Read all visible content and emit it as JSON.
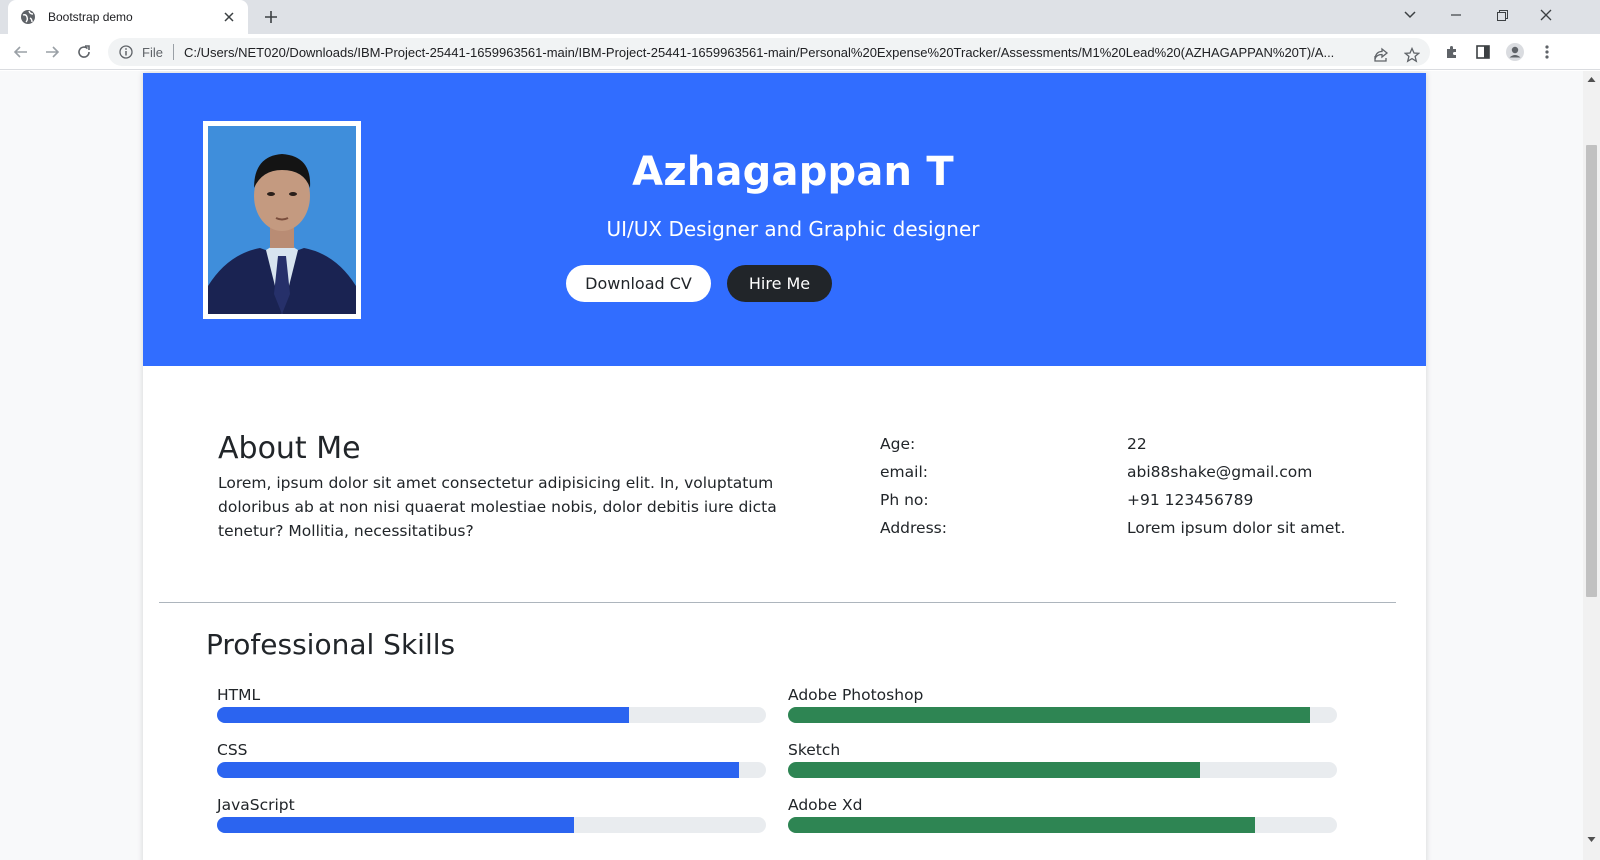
{
  "browser": {
    "tab_title": "Bootstrap demo",
    "omnibox_scheme": "File",
    "url": "C:/Users/NET020/Downloads/IBM-Project-25441-1659963561-main/IBM-Project-25441-1659963561-main/Personal%20Expense%20Tracker/Assessments/M1%20Lead%20(AZHAGAPPAN%20T)/A..."
  },
  "hero": {
    "name": "Azhagappan T",
    "title": "UI/UX Designer and Graphic designer",
    "download_label": "Download CV",
    "hire_label": "Hire Me",
    "background": "#316dff"
  },
  "about": {
    "heading": "About Me",
    "text": "Lorem, ipsum dolor sit amet consectetur adipisicing elit. In, voluptatum doloribus ab at non nisi quaerat molestiae nobis, dolor debitis iure dicta tenetur? Mollitia, necessitatibus?",
    "info": [
      {
        "label": "Age:",
        "value": "22"
      },
      {
        "label": "email:",
        "value": "abi88shake@gmail.com"
      },
      {
        "label": "Ph no:",
        "value": "+91 123456789"
      },
      {
        "label": "Address:",
        "value": "Lorem ipsum dolor sit amet."
      }
    ]
  },
  "skills": {
    "heading": "Professional Skills",
    "left": [
      {
        "name": "HTML",
        "percent": 75
      },
      {
        "name": "CSS",
        "percent": 95
      },
      {
        "name": "JavaScript",
        "percent": 65
      }
    ],
    "right": [
      {
        "name": "Adobe Photoshop",
        "percent": 95
      },
      {
        "name": "Sketch",
        "percent": 75
      },
      {
        "name": "Adobe Xd",
        "percent": 85
      }
    ],
    "left_color": "#2b64f0",
    "right_color": "#2e8553"
  }
}
